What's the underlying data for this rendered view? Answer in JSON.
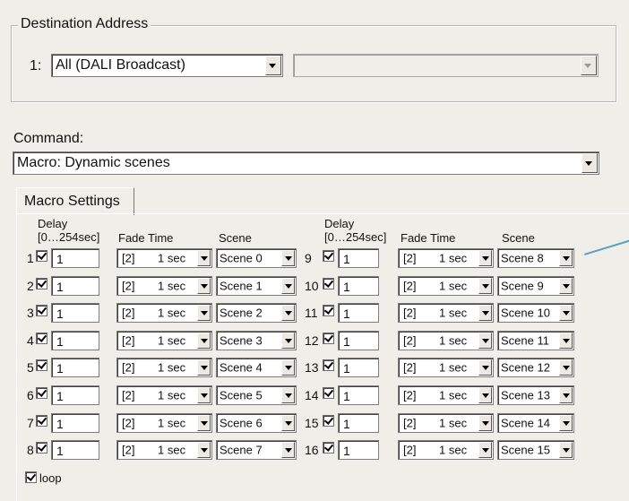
{
  "destination": {
    "title": "Destination Address",
    "row_label": "1:",
    "address_value": "All (DALI Broadcast)",
    "secondary_value": ""
  },
  "command": {
    "label": "Command:",
    "value": "Macro:  Dynamic scenes"
  },
  "macro": {
    "tab_label": "Macro Settings",
    "headers": {
      "delay_line1": "Delay",
      "delay_line2": "[0…254sec]",
      "fade_time": "Fade Time",
      "scene": "Scene"
    },
    "rows_left": [
      {
        "num": "1",
        "delay": "1",
        "fade_index": "[2]",
        "fade_value": "1 sec",
        "scene": "Scene 0"
      },
      {
        "num": "2",
        "delay": "1",
        "fade_index": "[2]",
        "fade_value": "1 sec",
        "scene": "Scene 1"
      },
      {
        "num": "3",
        "delay": "1",
        "fade_index": "[2]",
        "fade_value": "1 sec",
        "scene": "Scene 2"
      },
      {
        "num": "4",
        "delay": "1",
        "fade_index": "[2]",
        "fade_value": "1 sec",
        "scene": "Scene 3"
      },
      {
        "num": "5",
        "delay": "1",
        "fade_index": "[2]",
        "fade_value": "1 sec",
        "scene": "Scene 4"
      },
      {
        "num": "6",
        "delay": "1",
        "fade_index": "[2]",
        "fade_value": "1 sec",
        "scene": "Scene 5"
      },
      {
        "num": "7",
        "delay": "1",
        "fade_index": "[2]",
        "fade_value": "1 sec",
        "scene": "Scene 6"
      },
      {
        "num": "8",
        "delay": "1",
        "fade_index": "[2]",
        "fade_value": "1 sec",
        "scene": "Scene 7"
      }
    ],
    "rows_right": [
      {
        "num": "9",
        "delay": "1",
        "fade_index": "[2]",
        "fade_value": "1 sec",
        "scene": "Scene 8"
      },
      {
        "num": "10",
        "delay": "1",
        "fade_index": "[2]",
        "fade_value": "1 sec",
        "scene": "Scene 9"
      },
      {
        "num": "11",
        "delay": "1",
        "fade_index": "[2]",
        "fade_value": "1 sec",
        "scene": "Scene 10"
      },
      {
        "num": "12",
        "delay": "1",
        "fade_index": "[2]",
        "fade_value": "1 sec",
        "scene": "Scene 11"
      },
      {
        "num": "13",
        "delay": "1",
        "fade_index": "[2]",
        "fade_value": "1 sec",
        "scene": "Scene 12"
      },
      {
        "num": "14",
        "delay": "1",
        "fade_index": "[2]",
        "fade_value": "1 sec",
        "scene": "Scene 13"
      },
      {
        "num": "15",
        "delay": "1",
        "fade_index": "[2]",
        "fade_value": "1 sec",
        "scene": "Scene 14"
      },
      {
        "num": "16",
        "delay": "1",
        "fade_index": "[2]",
        "fade_value": "1 sec",
        "scene": "Scene 15"
      }
    ],
    "loop_label": "loop"
  }
}
